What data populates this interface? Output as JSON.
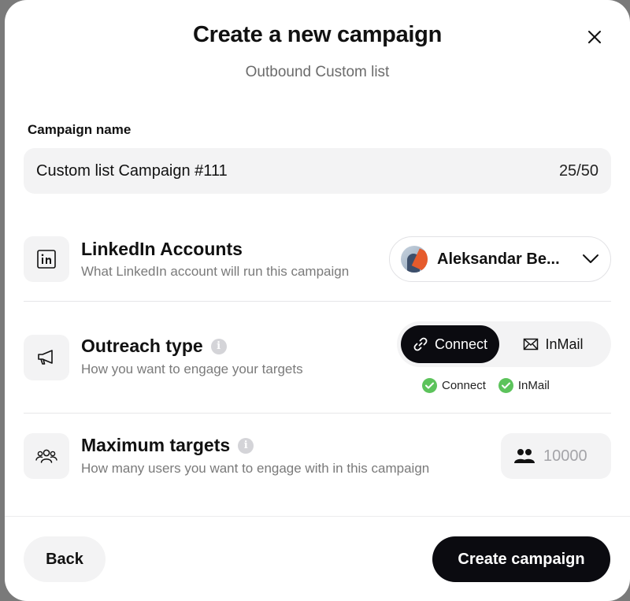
{
  "modal": {
    "title": "Create a new campaign",
    "subtitle": "Outbound Custom list"
  },
  "campaign_name": {
    "label": "Campaign name",
    "value": "Custom list Campaign #111",
    "counter": "25/50"
  },
  "linkedin_accounts": {
    "title": "LinkedIn Accounts",
    "description": "What LinkedIn account will run this campaign",
    "selected_account": "Aleksandar Be..."
  },
  "outreach_type": {
    "title": "Outreach type",
    "description": "How you want to engage your targets",
    "options": [
      {
        "label": "Connect",
        "active": true
      },
      {
        "label": "InMail",
        "active": false
      }
    ],
    "status": [
      "Connect",
      "InMail"
    ]
  },
  "max_targets": {
    "title": "Maximum targets",
    "description": "How many users you want to engage with in this campaign",
    "placeholder": "10000"
  },
  "footer": {
    "back_label": "Back",
    "create_label": "Create campaign"
  },
  "colors": {
    "primary": "#0b0b10",
    "surface": "#f3f3f4",
    "success": "#5cc35b",
    "muted_text": "#7a7a7a"
  }
}
